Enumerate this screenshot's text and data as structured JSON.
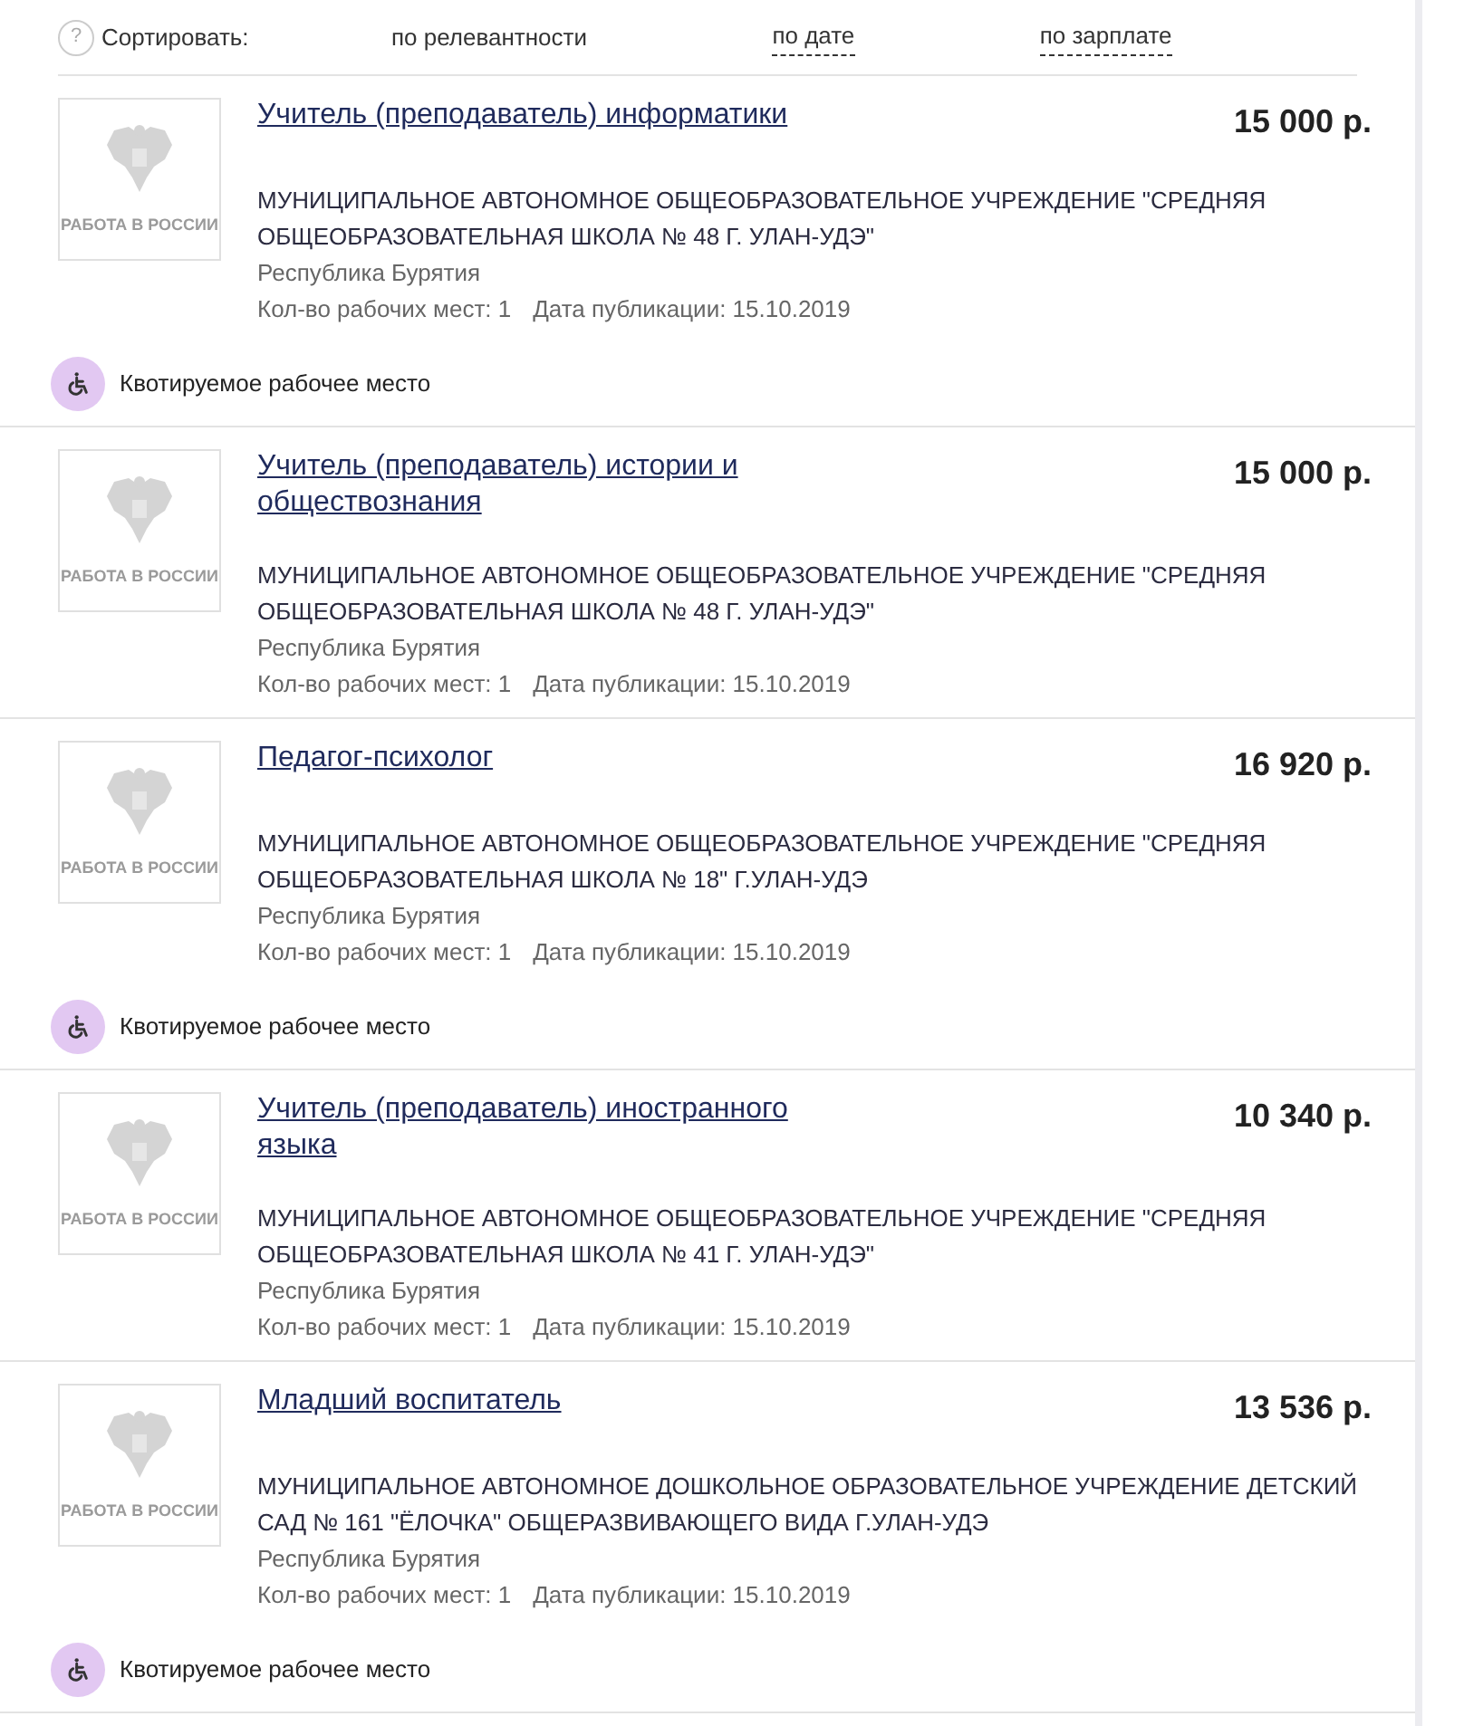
{
  "sort": {
    "help_icon": "?",
    "label": "Сортировать:",
    "options": [
      {
        "label": "по релевантности",
        "selected": true
      },
      {
        "label": "по дате",
        "selected": false
      },
      {
        "label": "по зарплате",
        "selected": false
      }
    ]
  },
  "vacancies": [
    {
      "logo_text": "РАБОТА В РОССИИ",
      "title": "Учитель (преподаватель) информатики",
      "salary": "15 000 р.",
      "employer": "МУНИЦИПАЛЬНОЕ АВТОНОМНОЕ ОБЩЕОБРАЗОВАТЕЛЬНОЕ УЧРЕЖДЕНИЕ \"СРЕДНЯЯ ОБЩЕОБРАЗОВАТЕЛЬНАЯ ШКОЛА № 48 Г. УЛАН-УДЭ\"",
      "region": "Республика Бурятия",
      "workplaces": "Кол-во рабочих мест: 1",
      "published": "Дата публикации: 15.10.2019",
      "quota": true,
      "quota_label": "Квотируемое рабочее место"
    },
    {
      "logo_text": "РАБОТА В РОССИИ",
      "title": "Учитель (преподаватель) истории и обществознания",
      "salary": "15 000 р.",
      "employer": "МУНИЦИПАЛЬНОЕ АВТОНОМНОЕ ОБЩЕОБРАЗОВАТЕЛЬНОЕ УЧРЕЖДЕНИЕ \"СРЕДНЯЯ ОБЩЕОБРАЗОВАТЕЛЬНАЯ ШКОЛА № 48 Г. УЛАН-УДЭ\"",
      "region": "Республика Бурятия",
      "workplaces": "Кол-во рабочих мест: 1",
      "published": "Дата публикации: 15.10.2019",
      "quota": false
    },
    {
      "logo_text": "РАБОТА В РОССИИ",
      "title": "Педагог-психолог",
      "salary": "16 920 р.",
      "employer": "МУНИЦИПАЛЬНОЕ АВТОНОМНОЕ ОБЩЕОБРАЗОВАТЕЛЬНОЕ УЧРЕЖДЕНИЕ \"СРЕДНЯЯ ОБЩЕОБРАЗОВАТЕЛЬНАЯ ШКОЛА № 18\" Г.УЛАН-УДЭ",
      "region": "Республика Бурятия",
      "workplaces": "Кол-во рабочих мест: 1",
      "published": "Дата публикации: 15.10.2019",
      "quota": true,
      "quota_label": "Квотируемое рабочее место"
    },
    {
      "logo_text": "РАБОТА В РОССИИ",
      "title": "Учитель (преподаватель) иностранного языка",
      "salary": "10 340 р.",
      "employer": "МУНИЦИПАЛЬНОЕ АВТОНОМНОЕ ОБЩЕОБРАЗОВАТЕЛЬНОЕ УЧРЕЖДЕНИЕ \"СРЕДНЯЯ ОБЩЕОБРАЗОВАТЕЛЬНАЯ ШКОЛА № 41 Г. УЛАН-УДЭ\"",
      "region": "Республика Бурятия",
      "workplaces": "Кол-во рабочих мест: 1",
      "published": "Дата публикации: 15.10.2019",
      "quota": false
    },
    {
      "logo_text": "РАБОТА В РОССИИ",
      "title": "Младший воспитатель",
      "salary": "13 536 р.",
      "employer": "МУНИЦИПАЛЬНОЕ АВТОНОМНОЕ ДОШКОЛЬНОЕ ОБРАЗОВАТЕЛЬНОЕ УЧРЕЖДЕНИЕ ДЕТСКИЙ САД № 161 \"ЁЛОЧКА\" ОБЩЕРАЗВИВАЮЩЕГО ВИДА Г.УЛАН-УДЭ",
      "region": "Республика Бурятия",
      "workplaces": "Кол-во рабочих мест: 1",
      "published": "Дата публикации: 15.10.2019",
      "quota": true,
      "quota_label": "Квотируемое рабочее место"
    }
  ]
}
